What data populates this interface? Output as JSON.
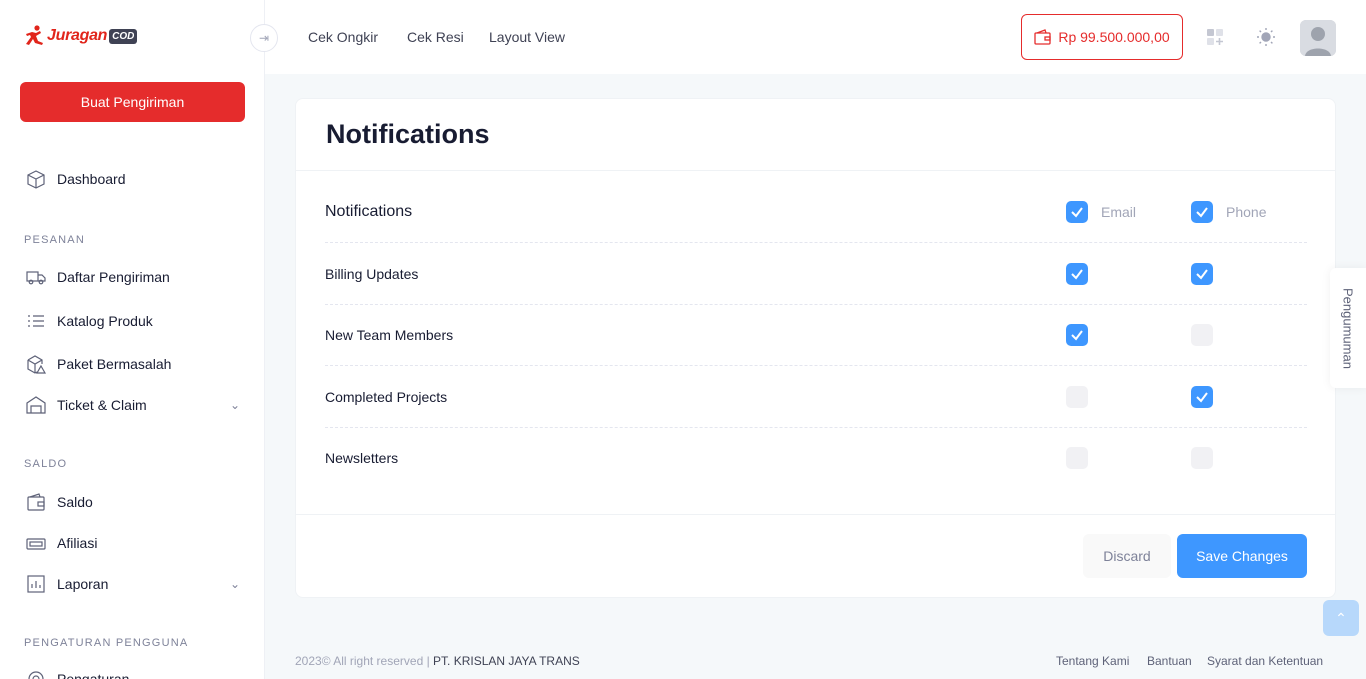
{
  "brand": {
    "name": "Juragan",
    "suffix": "COD"
  },
  "sidebar": {
    "create_button": "Buat Pengiriman",
    "dashboard": "Dashboard",
    "section_pesanan": "PESANAN",
    "pesanan_items": [
      "Daftar Pengiriman",
      "Katalog Produk",
      "Paket Bermasalah",
      "Ticket & Claim"
    ],
    "section_saldo": "SALDO",
    "saldo_items": [
      "Saldo",
      "Afiliasi",
      "Laporan"
    ],
    "section_pengaturan": "PENGATURAN PENGGUNA",
    "pengaturan_items": [
      "Pengaturan"
    ]
  },
  "header": {
    "nav": [
      "Cek Ongkir",
      "Cek Resi",
      "Layout View"
    ],
    "balance": "Rp 99.500.000,00"
  },
  "card": {
    "title": "Notifications",
    "header_label": "Notifications",
    "col_email": "Email",
    "col_phone": "Phone",
    "rows": [
      {
        "label": "Billing Updates",
        "email": true,
        "phone": true
      },
      {
        "label": "New Team Members",
        "email": true,
        "phone": false
      },
      {
        "label": "Completed Projects",
        "email": false,
        "phone": true
      },
      {
        "label": "Newsletters",
        "email": false,
        "phone": false
      }
    ],
    "header_email": true,
    "header_phone": true,
    "discard": "Discard",
    "save": "Save Changes"
  },
  "footer": {
    "copyright": "2023© All right reserved | ",
    "company": "PT. KRISLAN JAYA TRANS",
    "links": [
      "Tentang Kami",
      "Bantuan",
      "Syarat dan Ketentuan"
    ]
  },
  "side_tab": "Pengumuman",
  "colors": {
    "primary": "#3e97ff",
    "danger": "#e52c2c"
  }
}
